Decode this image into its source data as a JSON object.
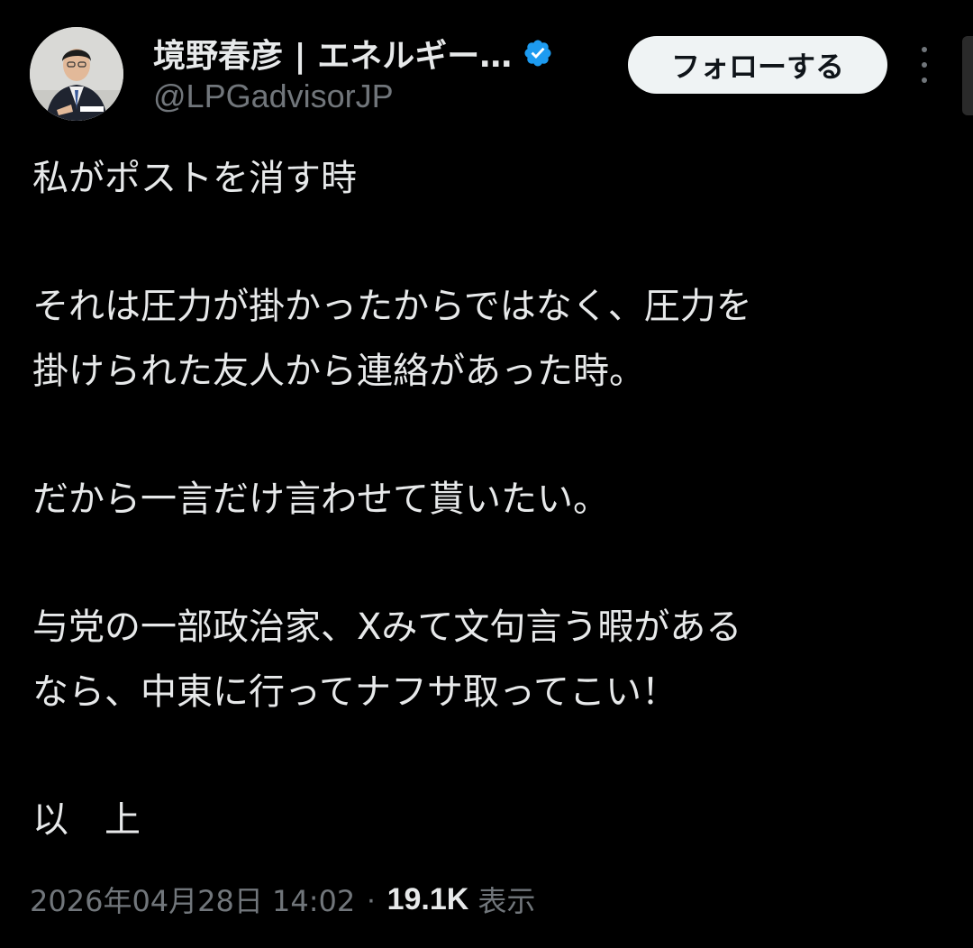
{
  "author": {
    "display_name": "境野春彦 | エネルギー…",
    "handle": "@LPGadvisorJP",
    "verified": true,
    "avatar_icon": "profile-photo"
  },
  "actions": {
    "follow_label": "フォローする",
    "more_icon": "more-vertical-icon"
  },
  "tweet": {
    "paragraphs": [
      [
        "私がポストを消す時"
      ],
      [
        "それは圧力が掛かったからではなく、圧力を",
        "掛けられた友人から連絡があった時。"
      ],
      [
        "だから一言だけ言わせて貰いたい。"
      ],
      [
        "与党の一部政治家、Xみて文句言う暇がある",
        "なら、中東に行ってナフサ取ってこい！"
      ],
      [
        "以　上"
      ]
    ]
  },
  "meta": {
    "timestamp": "2026年04月28日 14:02",
    "separator": "·",
    "views_count": "19.1K",
    "views_label": "表示"
  },
  "colors": {
    "background": "#000000",
    "text_primary": "#e7e9ea",
    "text_secondary": "#71767b",
    "verified_blue": "#1d9bf0",
    "follow_button_bg": "#eff3f4",
    "follow_button_text": "#0f1419"
  }
}
